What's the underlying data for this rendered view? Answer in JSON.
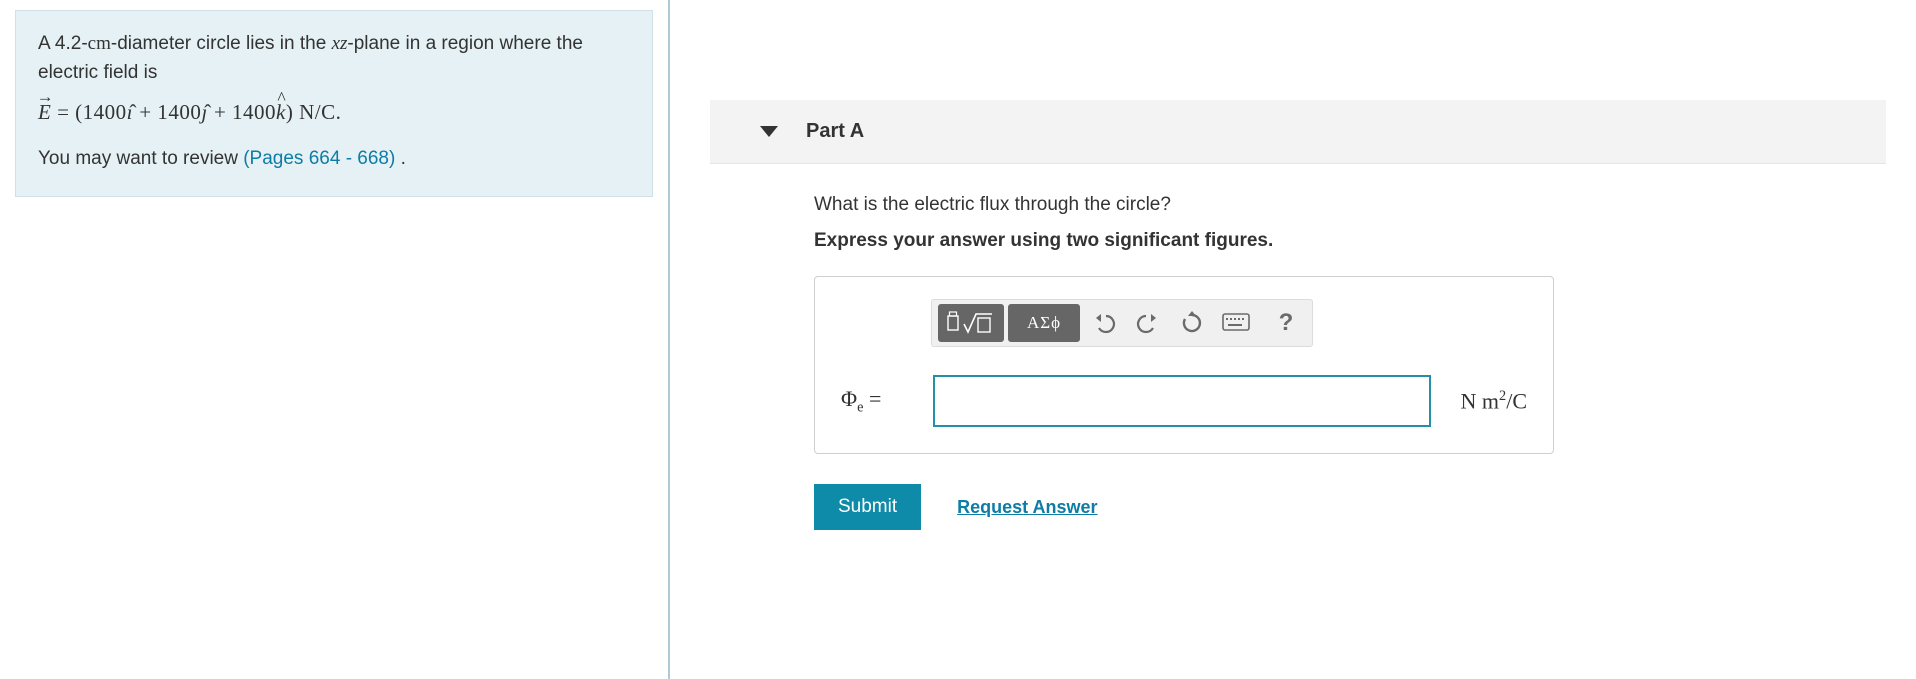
{
  "problem": {
    "intro_a": "A 4.2-",
    "intro_unit": "cm",
    "intro_b": "-diameter circle lies in the ",
    "plane": "xz",
    "intro_c": "-plane in a region where the electric field is",
    "eq_E": "E",
    "eq_eq": " = (1400",
    "eq_i": "ı",
    "eq_mid1": "̂ + 1400",
    "eq_j": "ȷ",
    "eq_mid2": "̂ + 1400",
    "eq_k": "k",
    "eq_end": ") N/C.",
    "review_a": "You may want to review ",
    "review_link": "(Pages 664 - 668)",
    "review_b": " ."
  },
  "part": {
    "title": "Part A",
    "question": "What is the electric flux through the circle?",
    "instruct": "Express your answer using two significant figures.",
    "label_phi": "Φ",
    "label_sub": "e",
    "label_eq": " = ",
    "unit_html": "N m²/C",
    "answer_value": ""
  },
  "toolbar": {
    "greek": "ΑΣϕ",
    "help": "?"
  },
  "actions": {
    "submit": "Submit",
    "request": "Request Answer"
  }
}
